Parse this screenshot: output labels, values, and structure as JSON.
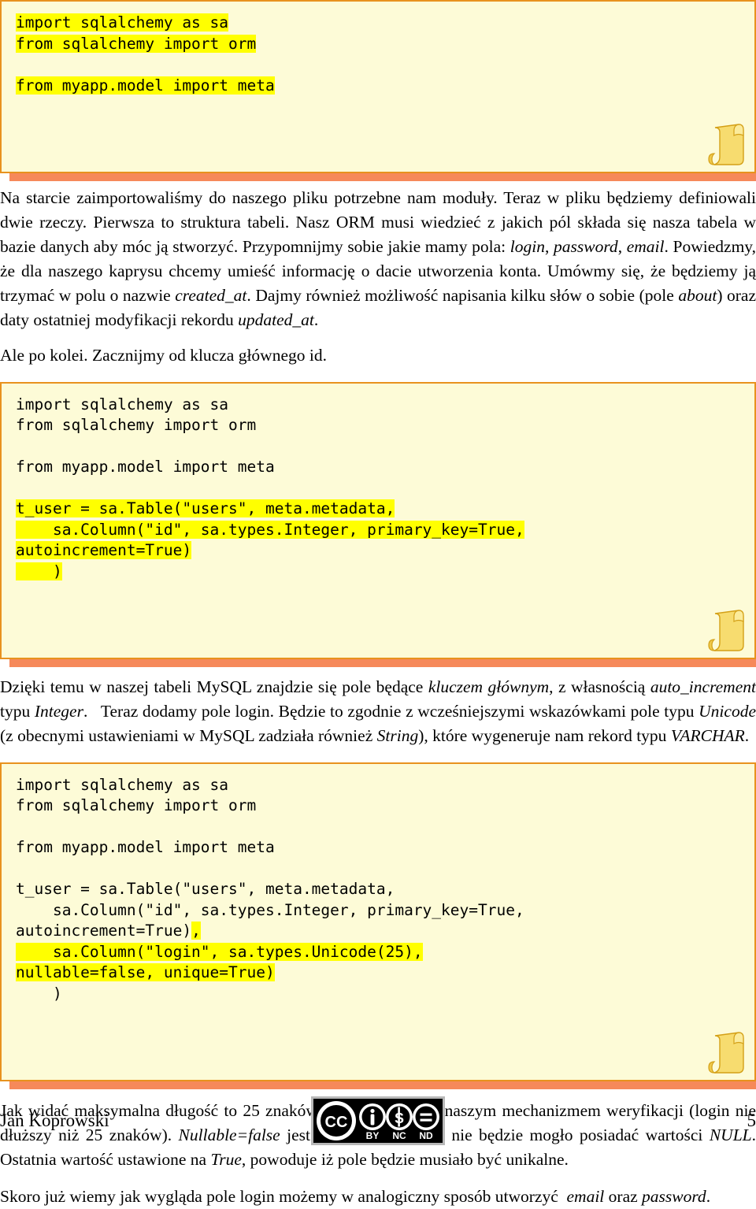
{
  "document": {
    "language": "pl",
    "author": "Jan Koprowski",
    "page_number": "5",
    "license_badge": {
      "name": "cc-by-nc-nd-badge",
      "cc": "CC",
      "terms": [
        "BY",
        "NC",
        "ND"
      ]
    }
  },
  "colors": {
    "code_background": "#FDFBD7",
    "code_border": "#E8921E",
    "code_shadow": "#F6895A",
    "highlight": "#FFFF00",
    "text": "#000000",
    "page_background": "#FFFFFF"
  },
  "code_blocks": [
    {
      "id": "code-block-1",
      "lines": [
        {
          "segments": [
            {
              "text": "import sqlalchemy as sa",
              "highlight": true
            }
          ]
        },
        {
          "segments": [
            {
              "text": "from sqlalchemy import orm",
              "highlight": true
            }
          ]
        },
        {
          "segments": [
            {
              "text": "",
              "highlight": false
            }
          ]
        },
        {
          "segments": [
            {
              "text": "from myapp.model import meta",
              "highlight": true
            }
          ]
        }
      ]
    },
    {
      "id": "code-block-2",
      "lines": [
        {
          "segments": [
            {
              "text": "import sqlalchemy as sa",
              "highlight": false
            }
          ]
        },
        {
          "segments": [
            {
              "text": "from sqlalchemy import orm",
              "highlight": false
            }
          ]
        },
        {
          "segments": [
            {
              "text": "",
              "highlight": false
            }
          ]
        },
        {
          "segments": [
            {
              "text": "from myapp.model import meta",
              "highlight": false
            }
          ]
        },
        {
          "segments": [
            {
              "text": "",
              "highlight": false
            }
          ]
        },
        {
          "segments": [
            {
              "text": "t_user = sa.Table(\"users\", meta.metadata,",
              "highlight": true
            }
          ]
        },
        {
          "segments": [
            {
              "text": "    sa.Column(\"id\", sa.types.Integer, primary_key=True,",
              "highlight": true
            }
          ]
        },
        {
          "segments": [
            {
              "text": "autoincrement=True)",
              "highlight": true
            }
          ]
        },
        {
          "segments": [
            {
              "text": "    )",
              "highlight": true
            }
          ]
        }
      ]
    },
    {
      "id": "code-block-3",
      "lines": [
        {
          "segments": [
            {
              "text": "import sqlalchemy as sa",
              "highlight": false
            }
          ]
        },
        {
          "segments": [
            {
              "text": "from sqlalchemy import orm",
              "highlight": false
            }
          ]
        },
        {
          "segments": [
            {
              "text": "",
              "highlight": false
            }
          ]
        },
        {
          "segments": [
            {
              "text": "from myapp.model import meta",
              "highlight": false
            }
          ]
        },
        {
          "segments": [
            {
              "text": "",
              "highlight": false
            }
          ]
        },
        {
          "segments": [
            {
              "text": "t_user = sa.Table(\"users\", meta.metadata,",
              "highlight": false
            }
          ]
        },
        {
          "segments": [
            {
              "text": "    sa.Column(\"id\", sa.types.Integer, primary_key=True,",
              "highlight": false
            }
          ]
        },
        {
          "segments": [
            {
              "text": "autoincrement=True)",
              "highlight": false
            },
            {
              "text": ",",
              "highlight": true
            }
          ]
        },
        {
          "segments": [
            {
              "text": "    sa.Column(\"login\", sa.types.Unicode(25),",
              "highlight": true
            }
          ]
        },
        {
          "segments": [
            {
              "text": "nullable=false, unique=True)",
              "highlight": true
            }
          ]
        },
        {
          "segments": [
            {
              "text": "    )",
              "highlight": false
            }
          ]
        }
      ]
    }
  ],
  "paragraphs": {
    "p1_html": "Na starcie zaimportowaliśmy do naszego pliku potrzebne nam moduły. Teraz w pliku będziemy definiowali dwie rzeczy. Pierwsza to struktura tabeli. Nasz ORM musi wiedzieć z jakich pól składa się nasza tabela w bazie danych aby móc ją stworzyć. Przypomnijmy sobie jakie mamy pola: <i>login</i>, <i>password</i>, <i>email</i>. Powiedzmy, że dla naszego kaprysu chcemy umieść informację o dacie utworzenia konta. Umówmy się, że będziemy ją trzymać w polu o nazwie <i>created_at</i>. Dajmy również możliwość napisania kilku słów o sobie (pole <i>about</i>) oraz daty ostatniej modyfikacji rekordu <i>updated_at</i>.",
    "p2_html": "Ale po kolei. Zacznijmy od klucza głównego id.",
    "p3_html": "Dzięki temu w naszej tabeli MySQL znajdzie się pole będące <i>kluczem głównym</i>, z własnością <i>auto_increment</i> typu <i>Integer</i>.&nbsp;&nbsp; Teraz dodamy pole login. Będzie to zgodnie z wcześniejszymi wskazówkami pole typu <i>Unicode</i> (z obecnymi ustawieniami w MySQL zadziała również <i>String</i>), które wygeneruje nam rekord typu <i>VARCHAR</i>.",
    "p4_html": "Jak widać maksymalna długość to 25 znaków. Jest to zgodne z naszym mechanizmem weryfikacji (login nie dłuższy niż 25 znaków). <i>Nullable=false</i> jest informacją iż pole nie będzie mogło posiadać wartości <i>NULL</i>. Ostatnia wartość ustawione na <i>True</i>, powoduje iż pole będzie musiało być unikalne.",
    "p5_html": "Skoro już wiemy jak wygląda pole login możemy w analogiczny sposób utworzyć&nbsp; <i>email</i> oraz <i>password</i>."
  }
}
